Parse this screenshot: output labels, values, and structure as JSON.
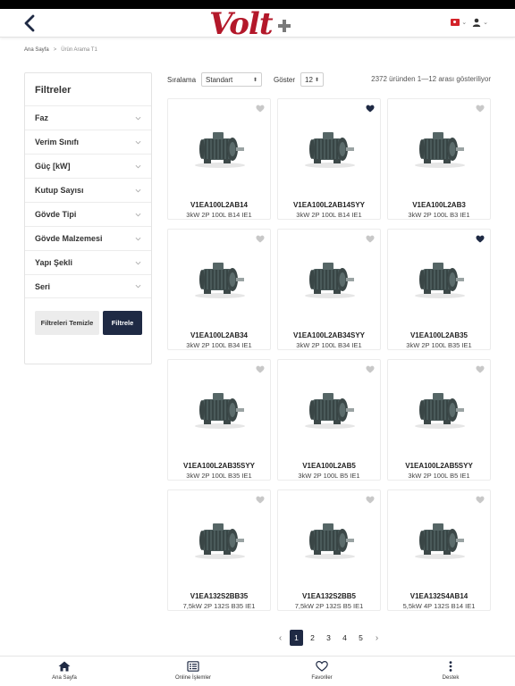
{
  "header": {
    "logo_text": "Volt",
    "language": "TR"
  },
  "breadcrumb": {
    "home": "Ana Sayfa",
    "sep": ">",
    "current": "Ürün Arama T1"
  },
  "filters": {
    "title": "Filtreler",
    "items": [
      "Faz",
      "Verim Sınıfı",
      "Güç [kW]",
      "Kutup Sayısı",
      "Gövde Tipi",
      "Gövde Malzemesi",
      "Yapı Şekli",
      "Seri"
    ],
    "clear_label": "Filtreleri Temizle",
    "apply_label": "Filtrele"
  },
  "toolbar": {
    "sort_label": "Sıralama",
    "sort_value": "Standart",
    "show_label": "Göster",
    "show_value": "12",
    "result_text": "2372 üründen 1—12 arası gösteriliyor"
  },
  "products": [
    {
      "code": "V1EA100L2AB14",
      "desc": "3kW 2P 100L B14 IE1",
      "favorite": false
    },
    {
      "code": "V1EA100L2AB14SYY",
      "desc": "3kW 2P 100L B14 IE1",
      "favorite": true
    },
    {
      "code": "V1EA100L2AB3",
      "desc": "3kW 2P 100L B3 IE1",
      "favorite": false
    },
    {
      "code": "V1EA100L2AB34",
      "desc": "3kW 2P 100L B34 IE1",
      "favorite": false
    },
    {
      "code": "V1EA100L2AB34SYY",
      "desc": "3kW 2P 100L B34 IE1",
      "favorite": false
    },
    {
      "code": "V1EA100L2AB35",
      "desc": "3kW 2P 100L B35 IE1",
      "favorite": true
    },
    {
      "code": "V1EA100L2AB35SYY",
      "desc": "3kW 2P 100L B35 IE1",
      "favorite": false
    },
    {
      "code": "V1EA100L2AB5",
      "desc": "3kW 2P 100L B5 IE1",
      "favorite": false
    },
    {
      "code": "V1EA100L2AB5SYY",
      "desc": "3kW 2P 100L B5 IE1",
      "favorite": false
    },
    {
      "code": "V1EA132S2BB35",
      "desc": "7,5kW 2P 132S B35 IE1",
      "favorite": false
    },
    {
      "code": "V1EA132S2BB5",
      "desc": "7,5kW 2P 132S B5 IE1",
      "favorite": false
    },
    {
      "code": "V1EA132S4AB14",
      "desc": "5,5kW 4P 132S B14 IE1",
      "favorite": false
    }
  ],
  "pagination": {
    "pages": [
      "1",
      "2",
      "3",
      "4",
      "5"
    ],
    "current": "1",
    "prev": "‹",
    "next": "›"
  },
  "bottom_nav": [
    {
      "label": "Ana Sayfa",
      "icon": "home-icon"
    },
    {
      "label": "Online İşlemler",
      "icon": "list-icon"
    },
    {
      "label": "Favoriler",
      "icon": "heart-icon"
    },
    {
      "label": "Destek",
      "icon": "more-vertical-icon"
    }
  ],
  "colors": {
    "brand_red": "#b3182a",
    "navy": "#1f2a44",
    "heart_empty": "#c8c8c8"
  }
}
